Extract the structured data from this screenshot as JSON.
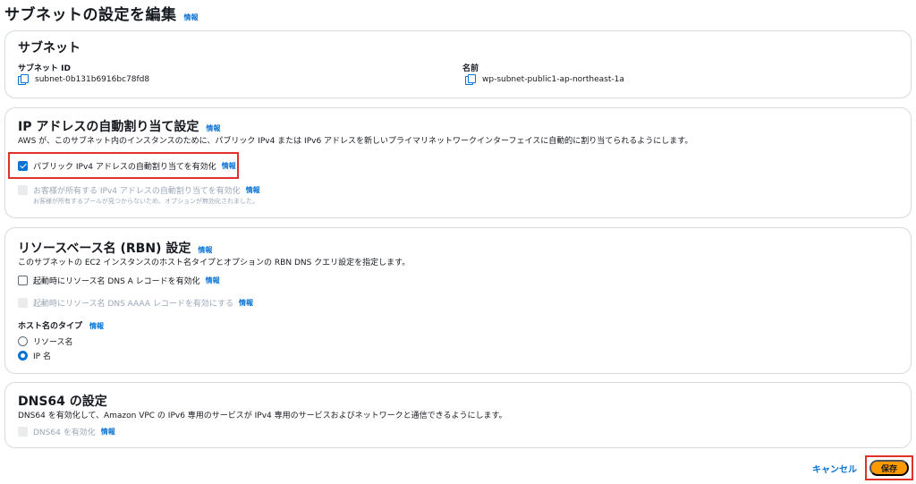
{
  "page": {
    "title": "サブネットの設定を編集",
    "info": "情報"
  },
  "subnet": {
    "heading": "サブネット",
    "id_label": "サブネット ID",
    "id_value": "subnet-0b131b6916bc78fd8",
    "name_label": "名前",
    "name_value": "wp-subnet-public1-ap-northeast-1a"
  },
  "ip": {
    "heading": "IP アドレスの自動割り当て設定",
    "info": "情報",
    "description": "AWS が、このサブネット内のインスタンスのために、パブリック IPv4 または IPv6 アドレスを新しいプライマリネットワークインターフェイスに自動的に割り当てられるようにします。",
    "auto_ipv4_label": "パブリック IPv4 アドレスの自動割り当てを有効化",
    "auto_ipv4_checked": true,
    "customer_ipv4_label": "お客様が所有する IPv4 アドレスの自動割り当てを有効化",
    "customer_ipv4_note": "お客様が所有するプールが見つからないため、オプションが無効化されました。"
  },
  "rbn": {
    "heading": "リソースベース名 (RBN) 設定",
    "info": "情報",
    "description": "このサブネットの EC2 インスタンスのホスト名タイプとオプションの RBN DNS クエリ設定を指定します。",
    "dns_a_label": "起動時にリソース名 DNS A レコードを有効化",
    "dns_aaaa_label": "起動時にリソース名 DNS AAAA レコードを有効にする",
    "hostname_type_label": "ホスト名のタイプ",
    "options": [
      "リソース名",
      "IP 名"
    ],
    "selected": "IP 名"
  },
  "dns64": {
    "heading": "DNS64 の設定",
    "description": "DNS64 を有効化して、Amazon VPC の IPv6 専用のサービスが IPv4 専用のサービスおよびネットワークと通信できるようにします。",
    "enable_label": "DNS64 を有効化",
    "info": "情報"
  },
  "footer": {
    "cancel": "キャンセル",
    "save": "保存"
  },
  "colors": {
    "accent": "#0972d3",
    "primary_button": "#ff9900",
    "highlight": "#e0312b"
  }
}
